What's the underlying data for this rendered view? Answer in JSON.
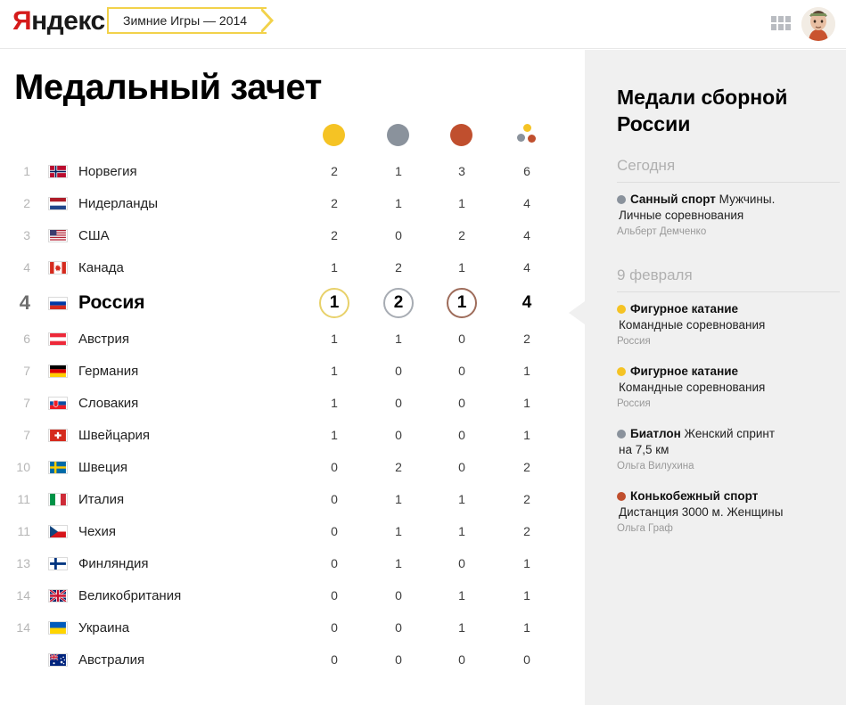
{
  "header": {
    "logo": "Яндекс",
    "logo_first_letter": "Я",
    "logo_rest": "ндекс",
    "tab_label": "Зимние Игры — 2014",
    "grid_icon": "apps-grid-icon",
    "avatar_icon": "user-avatar"
  },
  "main": {
    "title": "Медальный зачет",
    "columns": {
      "gold": "gold-medal-icon",
      "silver": "silver-medal-icon",
      "bronze": "bronze-medal-icon",
      "total": "total-medals-icon"
    },
    "rows": [
      {
        "rank": "1",
        "country": "Норвегия",
        "flag": "no",
        "gold": "2",
        "silver": "1",
        "bronze": "3",
        "total": "6",
        "highlight": false
      },
      {
        "rank": "2",
        "country": "Нидерланды",
        "flag": "nl",
        "gold": "2",
        "silver": "1",
        "bronze": "1",
        "total": "4",
        "highlight": false
      },
      {
        "rank": "3",
        "country": "США",
        "flag": "us",
        "gold": "2",
        "silver": "0",
        "bronze": "2",
        "total": "4",
        "highlight": false
      },
      {
        "rank": "4",
        "country": "Канада",
        "flag": "ca",
        "gold": "1",
        "silver": "2",
        "bronze": "1",
        "total": "4",
        "highlight": false
      },
      {
        "rank": "4",
        "country": "Россия",
        "flag": "ru",
        "gold": "1",
        "silver": "2",
        "bronze": "1",
        "total": "4",
        "highlight": true
      },
      {
        "rank": "6",
        "country": "Австрия",
        "flag": "at",
        "gold": "1",
        "silver": "1",
        "bronze": "0",
        "total": "2",
        "highlight": false
      },
      {
        "rank": "7",
        "country": "Германия",
        "flag": "de",
        "gold": "1",
        "silver": "0",
        "bronze": "0",
        "total": "1",
        "highlight": false
      },
      {
        "rank": "7",
        "country": "Словакия",
        "flag": "sk",
        "gold": "1",
        "silver": "0",
        "bronze": "0",
        "total": "1",
        "highlight": false
      },
      {
        "rank": "7",
        "country": "Швейцария",
        "flag": "ch",
        "gold": "1",
        "silver": "0",
        "bronze": "0",
        "total": "1",
        "highlight": false
      },
      {
        "rank": "10",
        "country": "Швеция",
        "flag": "se",
        "gold": "0",
        "silver": "2",
        "bronze": "0",
        "total": "2",
        "highlight": false
      },
      {
        "rank": "11",
        "country": "Италия",
        "flag": "it",
        "gold": "0",
        "silver": "1",
        "bronze": "1",
        "total": "2",
        "highlight": false
      },
      {
        "rank": "11",
        "country": "Чехия",
        "flag": "cz",
        "gold": "0",
        "silver": "1",
        "bronze": "1",
        "total": "2",
        "highlight": false
      },
      {
        "rank": "13",
        "country": "Финляндия",
        "flag": "fi",
        "gold": "0",
        "silver": "1",
        "bronze": "0",
        "total": "1",
        "highlight": false
      },
      {
        "rank": "14",
        "country": "Великобритания",
        "flag": "gb",
        "gold": "0",
        "silver": "0",
        "bronze": "1",
        "total": "1",
        "highlight": false
      },
      {
        "rank": "14",
        "country": "Украина",
        "flag": "ua",
        "gold": "0",
        "silver": "0",
        "bronze": "1",
        "total": "1",
        "highlight": false
      },
      {
        "rank": "",
        "country": "Австралия",
        "flag": "au",
        "gold": "0",
        "silver": "0",
        "bronze": "0",
        "total": "0",
        "highlight": false
      }
    ]
  },
  "sidebar": {
    "title": "Медали сборной России",
    "sections": [
      {
        "heading": "Сегодня",
        "events": [
          {
            "medal": "silver",
            "sport": "Санный спорт",
            "discipline_inline": "Мужчины.",
            "discipline_next": "Личные соревнования",
            "athlete": "Альберт Демченко"
          }
        ]
      },
      {
        "heading": "9 февраля",
        "events": [
          {
            "medal": "gold",
            "sport": "Фигурное катание",
            "discipline_inline": "",
            "discipline_next": "Командные соревнования",
            "athlete": "Россия"
          },
          {
            "medal": "gold",
            "sport": "Фигурное катание",
            "discipline_inline": "",
            "discipline_next": "Командные соревнования",
            "athlete": "Россия"
          },
          {
            "medal": "silver",
            "sport": "Биатлон",
            "discipline_inline": "Женский спринт",
            "discipline_next": "на 7,5 км",
            "athlete": "Ольга Вилухина"
          },
          {
            "medal": "bronze",
            "sport": "Конькобежный спорт",
            "discipline_inline": "",
            "discipline_next": "Дистанция 3000 м. Женщины",
            "athlete": "Ольга Граф"
          }
        ]
      }
    ]
  },
  "colors": {
    "gold": "#F5C324",
    "silver": "#8A929C",
    "bronze": "#C04F2E",
    "gold_ring": "#E8D16A",
    "silver_ring": "#A7ACB3",
    "bronze_ring": "#9E6C5A",
    "brand_yellow": "#F2D24A",
    "logo_red": "#D51B1B",
    "sidebar_bg": "#F0F0F0"
  }
}
